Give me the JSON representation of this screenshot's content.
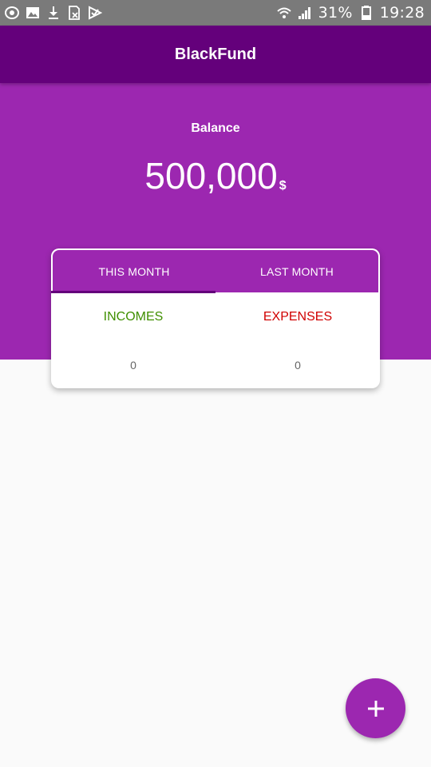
{
  "status_bar": {
    "battery_percent": "31%",
    "time": "19:28",
    "left_icons": [
      "eye-icon",
      "image-icon",
      "download-icon",
      "sim-card-icon",
      "play-icon"
    ],
    "right_icons": [
      "wifi-icon",
      "signal-icon",
      "battery-icon"
    ]
  },
  "app_bar": {
    "title": "BlackFund"
  },
  "balance": {
    "label": "Balance",
    "amount": "500,000",
    "currency": "$"
  },
  "tabs": [
    {
      "label": "THIS MONTH",
      "selected": true
    },
    {
      "label": "LAST MONTH",
      "selected": false
    }
  ],
  "summary": {
    "incomes": {
      "label": "INCOMES",
      "value": "0",
      "color": "#3f8f00"
    },
    "expenses": {
      "label": "EXPENSES",
      "value": "0",
      "color": "#d00000"
    }
  },
  "fab": {
    "icon": "plus-icon"
  },
  "colors": {
    "primary": "#9c27b0",
    "primary_dark": "#64007b",
    "background": "#fafafa",
    "status_bar": "#7a7a7a"
  }
}
